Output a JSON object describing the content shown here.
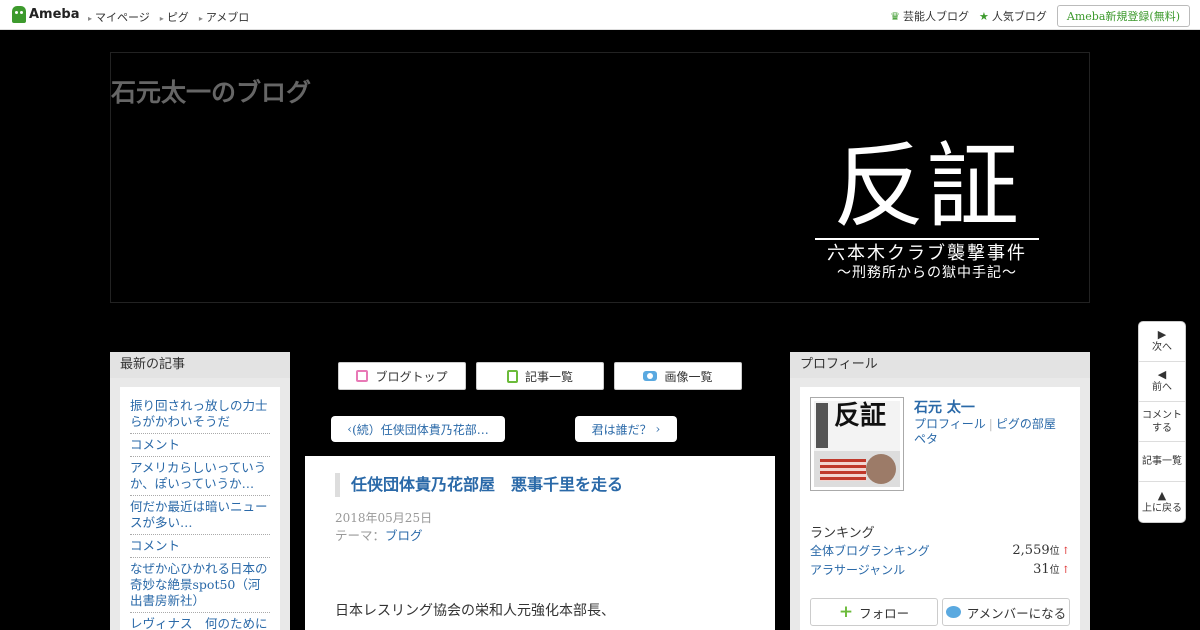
{
  "topbar": {
    "logo": "Ameba",
    "nav": [
      "マイページ",
      "ピグ",
      "アメブロ"
    ],
    "right_links": [
      {
        "label": "芸能人ブログ",
        "icon": "crown-icon"
      },
      {
        "label": "人気ブログ",
        "icon": "star-icon"
      }
    ],
    "register": "Ameba新規登録(無料)"
  },
  "header": {
    "blog_title": "石元太一のブログ",
    "hero_main": "反証",
    "hero_sub": "六本木クラブ襲撃事件",
    "hero_sub2": "〜刑務所からの獄中手記〜"
  },
  "left_sidebar": {
    "heading": "最新の記事",
    "items": [
      "振り回されっ放しの力士らがかわいそうだ",
      "コメント",
      "アメリカらしいっていうか、ぽいっていうか…",
      "何だか最近は暗いニュースが多い…",
      "コメント",
      "なぜか心ひかれる日本の奇妙な絶景spot50（河出書房新社）",
      "レヴィナス　何のために"
    ]
  },
  "center": {
    "buttons": [
      "ブログトップ",
      "記事一覧",
      "画像一覧"
    ],
    "prev": "(続）任侠団体貴乃花部…",
    "next": "君は誰だ？",
    "article": {
      "title": "任侠団体貴乃花部屋　悪事千里を走る",
      "date": "2018年05月25日",
      "theme_label": "テーマ：",
      "theme_value": "ブログ",
      "body": "日本レスリング協会の栄和人元強化本部長、"
    }
  },
  "right_sidebar": {
    "heading": "プロフィール",
    "name": "石元 太一",
    "link_profile": "プロフィール",
    "link_room": "ピグの部屋",
    "link_peta": "ペタ",
    "book_title": "反証",
    "ranking_label": "ランキング",
    "rankings": [
      {
        "label": "全体ブログランキング",
        "value": "2,559",
        "unit": "位",
        "trend": "↑"
      },
      {
        "label": "アラサージャンル",
        "value": "31",
        "unit": "位",
        "trend": "↑"
      }
    ],
    "follow": "フォロー",
    "amember": "アメンバーになる"
  },
  "float_nav": [
    {
      "arrow": "▶",
      "label": "次へ"
    },
    {
      "arrow": "◀",
      "label": "前へ"
    },
    {
      "arrow": "",
      "label": "コメント\nする"
    },
    {
      "arrow": "",
      "label": "記事一覧"
    },
    {
      "arrow": "▲",
      "label": "上に戻る"
    }
  ],
  "colors": {
    "brand_green": "#3d9a2d",
    "link_blue": "#2a69a8",
    "background": "#000000"
  }
}
